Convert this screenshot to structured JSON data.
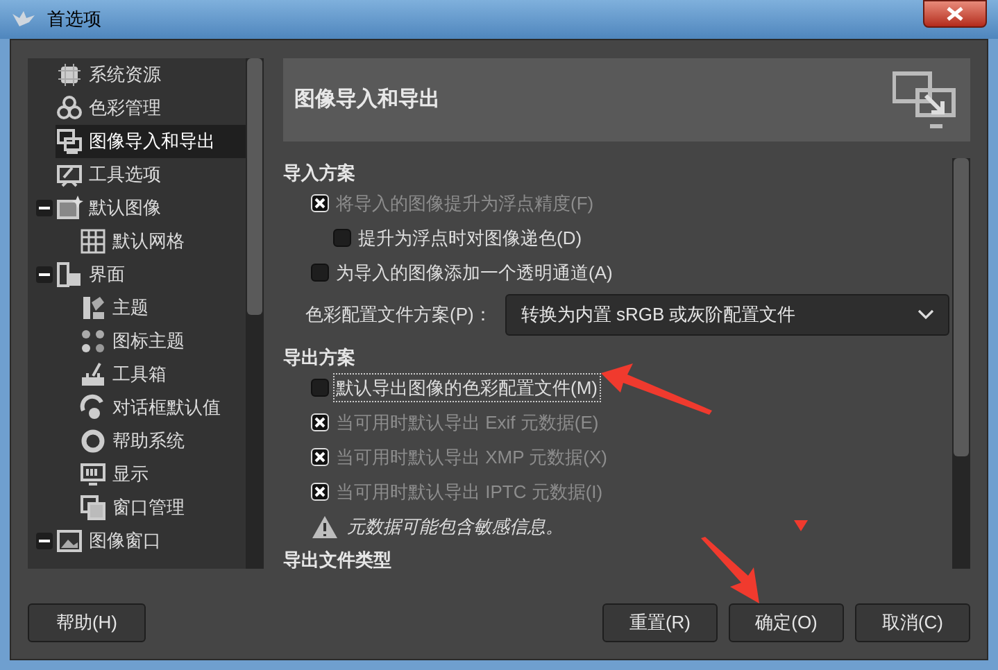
{
  "window": {
    "title": "首选项"
  },
  "sidebar": {
    "items": [
      {
        "label": "系统资源",
        "selected": false
      },
      {
        "label": "色彩管理",
        "selected": false
      },
      {
        "label": "图像导入和导出",
        "selected": true
      },
      {
        "label": "工具选项",
        "selected": false
      },
      {
        "label": "默认图像",
        "selected": false,
        "expanded": true,
        "children": [
          {
            "label": "默认网格",
            "selected": false
          }
        ]
      },
      {
        "label": "界面",
        "selected": false,
        "expanded": true,
        "children": [
          {
            "label": "主题",
            "selected": false
          },
          {
            "label": "图标主题",
            "selected": false
          },
          {
            "label": "工具箱",
            "selected": false
          },
          {
            "label": "对话框默认值",
            "selected": false
          },
          {
            "label": "帮助系统",
            "selected": false
          },
          {
            "label": "显示",
            "selected": false
          },
          {
            "label": "窗口管理",
            "selected": false
          }
        ]
      },
      {
        "label": "图像窗口",
        "selected": false,
        "expanded": true
      }
    ]
  },
  "panel": {
    "title": "图像导入和导出",
    "sections": [
      {
        "heading": "导入方案",
        "rows": [
          {
            "kind": "checkbox",
            "label": "将导入的图像提升为浮点精度(F)",
            "checked": true,
            "disabled": true,
            "indent": false
          },
          {
            "kind": "checkbox",
            "label": "提升为浮点时对图像递色(D)",
            "checked": false,
            "disabled": false,
            "indent": true
          },
          {
            "kind": "checkbox",
            "label": "为导入的图像添加一个透明通道(A)",
            "checked": false,
            "disabled": false,
            "indent": false
          },
          {
            "kind": "dropdown",
            "label": "色彩配置文件方案(P)：",
            "value": "转换为内置 sRGB 或灰阶配置文件"
          }
        ]
      },
      {
        "heading": "导出方案",
        "rows": [
          {
            "kind": "checkbox",
            "label": "默认导出图像的色彩配置文件(M)",
            "checked": false,
            "disabled": false,
            "indent": false,
            "focused": true
          },
          {
            "kind": "checkbox",
            "label": "当可用时默认导出 Exif 元数据(E)",
            "checked": true,
            "disabled": true,
            "indent": false
          },
          {
            "kind": "checkbox",
            "label": "当可用时默认导出 XMP 元数据(X)",
            "checked": true,
            "disabled": true,
            "indent": false
          },
          {
            "kind": "checkbox",
            "label": "当可用时默认导出 IPTC 元数据(I)",
            "checked": true,
            "disabled": true,
            "indent": false
          },
          {
            "kind": "warning",
            "label": "元数据可能包含敏感信息。"
          }
        ]
      },
      {
        "heading": "导出文件类型"
      }
    ]
  },
  "help_button": {
    "label": "帮助(H)"
  },
  "buttons": [
    {
      "label": "重置(R)"
    },
    {
      "label": "确定(O)"
    },
    {
      "label": "取消(C)"
    }
  ]
}
